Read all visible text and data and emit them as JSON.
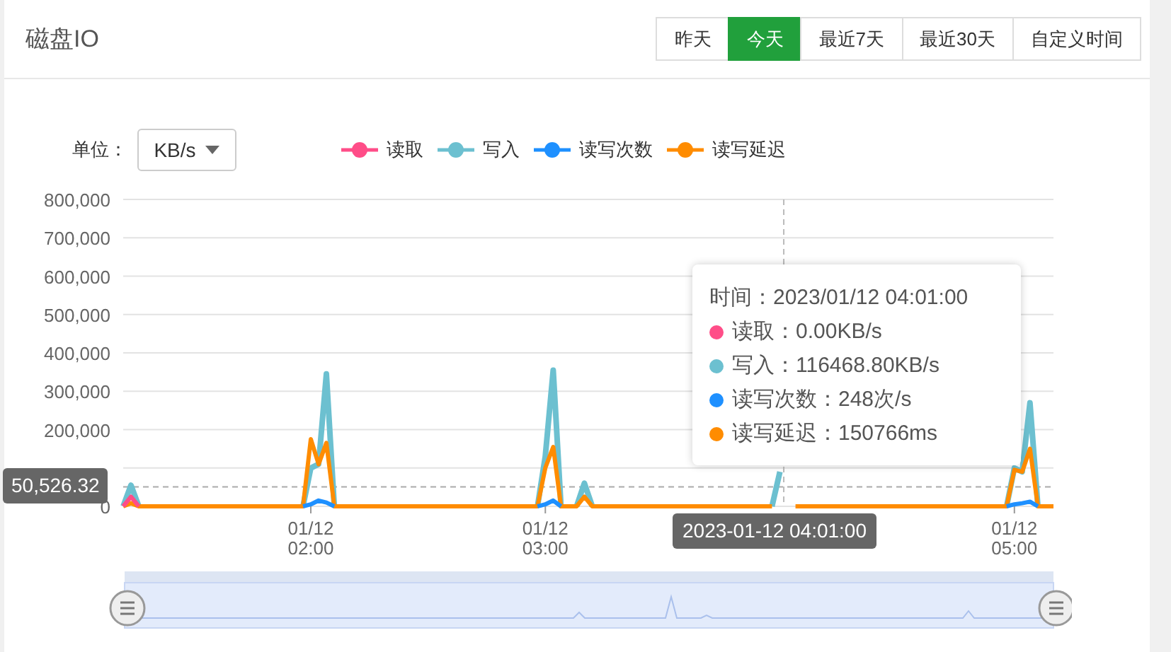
{
  "card": {
    "title": "磁盘IO"
  },
  "ranges": [
    {
      "label": "昨天",
      "selected": false
    },
    {
      "label": "今天",
      "selected": true
    },
    {
      "label": "最近7天",
      "selected": false
    },
    {
      "label": "最近30天",
      "selected": false
    },
    {
      "label": "自定义时间",
      "selected": false
    }
  ],
  "unit": {
    "label": "单位：",
    "value": "KB/s"
  },
  "chart": {
    "chart_data": {
      "type": "line",
      "categories": [
        null,
        null,
        null,
        null,
        null,
        null,
        null,
        null,
        null,
        null,
        null,
        null,
        null,
        null,
        null,
        null,
        null,
        null,
        null,
        null,
        null,
        null,
        null,
        null,
        "01/12 02:00",
        null,
        null,
        null,
        null,
        null,
        null,
        null,
        null,
        null,
        null,
        null,
        null,
        null,
        null,
        null,
        null,
        null,
        null,
        null,
        null,
        null,
        null,
        null,
        null,
        null,
        null,
        null,
        null,
        null,
        "01/12 03:00",
        null,
        null,
        null,
        null,
        null,
        null,
        null,
        null,
        null,
        null,
        null,
        null,
        null,
        null,
        null,
        null,
        null,
        null,
        null,
        null,
        null,
        null,
        null,
        null,
        null,
        null,
        null,
        null,
        null,
        null,
        null,
        null,
        null,
        null,
        null,
        null,
        null,
        null,
        null,
        null,
        null,
        null,
        null,
        null,
        null,
        null,
        null,
        null,
        null,
        null,
        null,
        null,
        null,
        null,
        null,
        null,
        null,
        null,
        null,
        "01/12 05:00",
        null,
        null,
        null,
        null,
        null
      ],
      "series": [
        {
          "name": "读取",
          "color": "#ff4d88",
          "values": [
            0,
            25000,
            0,
            null,
            null,
            null,
            null,
            null,
            null,
            null,
            null,
            null,
            null,
            null,
            null,
            null,
            null,
            null,
            null,
            null,
            null,
            null,
            null,
            null,
            null,
            null,
            null,
            null,
            null,
            null,
            null,
            null,
            null,
            null,
            null,
            null,
            null,
            null,
            null,
            null,
            null,
            null,
            null,
            null,
            null,
            null,
            null,
            null,
            null,
            null,
            null,
            null,
            null,
            null,
            null,
            null,
            null,
            null,
            null,
            null,
            null,
            null,
            null,
            null,
            null,
            null,
            null,
            null,
            null,
            null,
            null,
            null,
            null,
            null,
            null,
            null,
            null,
            null,
            null,
            null,
            null,
            null,
            null,
            null,
            null,
            null,
            null,
            null,
            null,
            null,
            null,
            null,
            null,
            null,
            null,
            null,
            null,
            null,
            null,
            null,
            null,
            null,
            null,
            null,
            null,
            null,
            null,
            null,
            null,
            null,
            null,
            null,
            null,
            null,
            null,
            null,
            null,
            null,
            null,
            null
          ]
        },
        {
          "name": "写入",
          "color": "#6cc0d0",
          "values": [
            0,
            55000,
            0,
            null,
            null,
            null,
            null,
            null,
            null,
            null,
            null,
            null,
            null,
            null,
            null,
            null,
            null,
            null,
            null,
            null,
            null,
            null,
            null,
            0,
            100000,
            110000,
            345000,
            0,
            null,
            null,
            null,
            null,
            null,
            null,
            null,
            null,
            null,
            null,
            null,
            null,
            null,
            null,
            null,
            null,
            null,
            null,
            null,
            null,
            null,
            null,
            null,
            null,
            null,
            0,
            130000,
            355000,
            0,
            null,
            0,
            60000,
            0,
            null,
            null,
            null,
            null,
            null,
            null,
            null,
            null,
            null,
            null,
            null,
            null,
            null,
            null,
            null,
            null,
            null,
            null,
            null,
            null,
            null,
            null,
            0,
            90000,
            null,
            null,
            null,
            null,
            null,
            null,
            null,
            null,
            null,
            null,
            null,
            null,
            null,
            null,
            null,
            null,
            null,
            null,
            null,
            null,
            null,
            null,
            null,
            null,
            null,
            null,
            null,
            null,
            0,
            100000,
            90000,
            270000,
            0,
            null,
            null
          ]
        },
        {
          "name": "读写次数",
          "color": "#1e90ff",
          "values": [
            null,
            null,
            null,
            null,
            null,
            null,
            null,
            null,
            null,
            null,
            null,
            null,
            null,
            null,
            null,
            null,
            null,
            null,
            null,
            null,
            null,
            null,
            null,
            0,
            5000,
            15000,
            10000,
            0,
            null,
            null,
            null,
            null,
            null,
            null,
            null,
            null,
            null,
            null,
            null,
            null,
            null,
            null,
            null,
            null,
            null,
            null,
            null,
            null,
            null,
            null,
            null,
            null,
            null,
            0,
            5000,
            15000,
            0,
            null,
            null,
            null,
            null,
            null,
            null,
            null,
            null,
            null,
            null,
            null,
            null,
            null,
            null,
            null,
            null,
            null,
            null,
            null,
            null,
            null,
            null,
            null,
            null,
            null,
            null,
            null,
            null,
            null,
            null,
            null,
            null,
            null,
            null,
            null,
            null,
            null,
            null,
            null,
            null,
            null,
            null,
            null,
            null,
            null,
            null,
            null,
            null,
            null,
            null,
            null,
            null,
            null,
            null,
            null,
            null,
            0,
            5000,
            8000,
            12000,
            0,
            null,
            null
          ]
        },
        {
          "name": "读写延迟",
          "color": "#ff8c00",
          "values": [
            0,
            8000,
            0,
            0,
            0,
            0,
            0,
            0,
            0,
            0,
            0,
            0,
            0,
            0,
            0,
            0,
            0,
            0,
            0,
            0,
            0,
            0,
            0,
            0,
            175000,
            110000,
            165000,
            0,
            0,
            0,
            0,
            0,
            0,
            0,
            0,
            0,
            0,
            0,
            0,
            0,
            0,
            0,
            0,
            0,
            0,
            0,
            0,
            0,
            0,
            0,
            0,
            0,
            0,
            0,
            100000,
            155000,
            0,
            0,
            0,
            25000,
            0,
            0,
            0,
            0,
            0,
            0,
            0,
            0,
            0,
            0,
            0,
            0,
            0,
            0,
            0,
            0,
            0,
            0,
            0,
            0,
            0,
            0,
            0,
            0,
            null,
            null,
            0,
            0,
            0,
            0,
            0,
            0,
            0,
            0,
            0,
            0,
            0,
            0,
            0,
            0,
            0,
            0,
            0,
            0,
            0,
            0,
            0,
            0,
            0,
            0,
            0,
            0,
            0,
            0,
            95000,
            90000,
            150000,
            0,
            0,
            0
          ]
        }
      ],
      "ylim": [
        0,
        800000
      ],
      "grid": true,
      "ref_lines": [
        {
          "axis": "y",
          "value": 50526.32
        }
      ],
      "yticks": [
        {
          "value": 0,
          "label": "0"
        },
        {
          "value": 200000,
          "label": "200,000"
        },
        {
          "value": 300000,
          "label": "300,000"
        },
        {
          "value": 400000,
          "label": "400,000"
        },
        {
          "value": 500000,
          "label": "500,000"
        },
        {
          "value": 600000,
          "label": "600,000"
        },
        {
          "value": 700000,
          "label": "700,000"
        },
        {
          "value": 800000,
          "label": "800,000"
        }
      ]
    },
    "pointer": {
      "y_label": "50,526.32",
      "x_label": "2023-01-12 04:01:00"
    },
    "tooltip": {
      "title": "时间：2023/01/12 04:01:00",
      "rows": [
        {
          "text": "读取：0.00KB/s",
          "color": "#ff4d88"
        },
        {
          "text": "写入：116468.80KB/s",
          "color": "#6cc0d0"
        },
        {
          "text": "读写次数：248次/s",
          "color": "#1e90ff"
        },
        {
          "text": "读写延迟：150766ms",
          "color": "#ff8c00"
        }
      ]
    }
  },
  "zoom_slider": {
    "level": 1
  }
}
